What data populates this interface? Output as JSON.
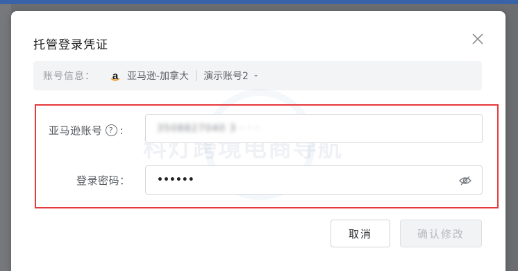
{
  "dialog": {
    "title": "托管登录凭证",
    "close_icon": "close-icon"
  },
  "info": {
    "label": "账号信息：",
    "store_icon": "amazon-logo",
    "store": "亚马逊-加拿大",
    "account": "演示账号2",
    "dash": "-"
  },
  "watermark": "科灯跨境电商导航",
  "form": {
    "account_label": "亚马逊账号",
    "account_label_colon": ":",
    "help_icon": "question-circle-icon",
    "account_value": "3508827040 3  · · ·",
    "password_label": "登录密码：",
    "password_value": "••••••",
    "eye_icon": "eye-slash-icon"
  },
  "buttons": {
    "cancel": "取消",
    "confirm": "确认修改"
  },
  "colors": {
    "highlight_border": "#e6393b",
    "top_strip": "#3a62a6"
  }
}
